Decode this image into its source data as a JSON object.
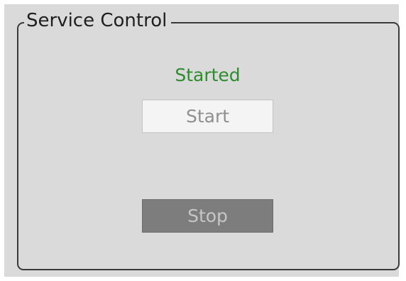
{
  "groupbox": {
    "title": "Service Control"
  },
  "status": {
    "text": "Started",
    "color": "#2e8b2e"
  },
  "buttons": {
    "start_label": "Start",
    "stop_label": "Stop"
  }
}
